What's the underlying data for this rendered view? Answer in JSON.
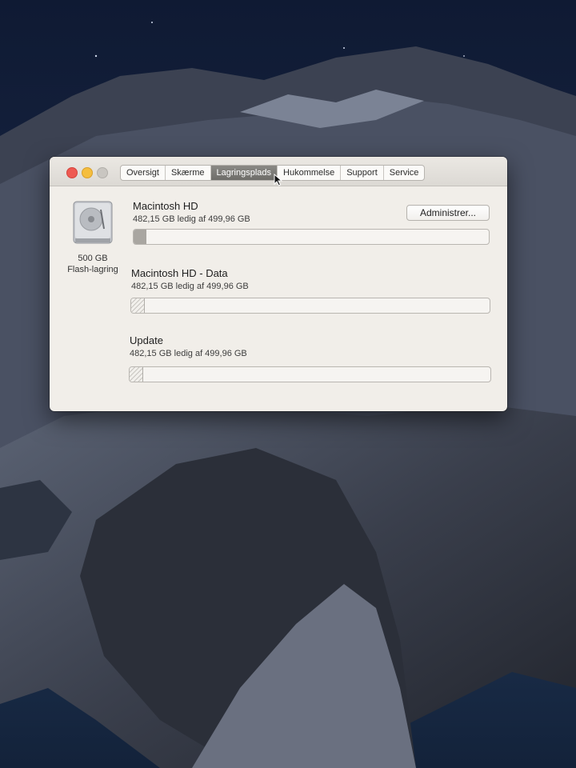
{
  "window": {
    "tabs": [
      {
        "label": "Oversigt"
      },
      {
        "label": "Skærme"
      },
      {
        "label": "Lagringsplads",
        "active": true
      },
      {
        "label": "Hukommelse"
      },
      {
        "label": "Support"
      },
      {
        "label": "Service"
      }
    ],
    "drive": {
      "icon": "hard-drive-icon",
      "capacity": "500 GB",
      "type": "Flash-lagring"
    },
    "manage_button": "Administrer...",
    "volumes": [
      {
        "name": "Macintosh HD",
        "free_text": "482,15 GB ledig af 499,96 GB",
        "used_fraction": 0.036,
        "fill_style": "solid"
      },
      {
        "name": "Macintosh HD - Data",
        "free_text": "482,15 GB ledig af 499,96 GB",
        "used_fraction": 0.036,
        "fill_style": "hatched"
      },
      {
        "name": "Update",
        "free_text": "482,15 GB ledig af 499,96 GB",
        "used_fraction": 0.036,
        "fill_style": "hatched"
      }
    ]
  },
  "colors": {
    "window_bg": "#f1eee9",
    "active_tab": "#7c7b77",
    "close": "#ee5a52",
    "minimize": "#f5be3f",
    "zoom_disabled": "#c9c6c1"
  }
}
